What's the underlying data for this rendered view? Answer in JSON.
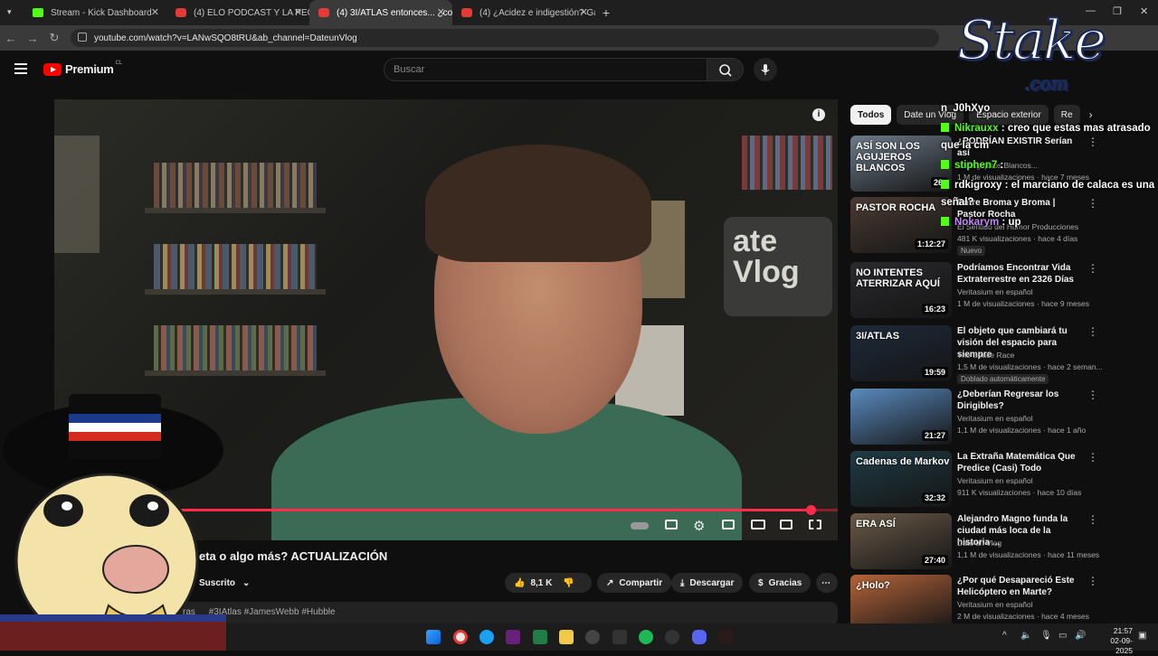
{
  "browser": {
    "tabs": [
      {
        "title": "Stream - Kick Dashboard",
        "icon": "kick-icon"
      },
      {
        "title": "(4) ELO PODCAST Y LA PEOR EN",
        "icon": "youtube-icon"
      },
      {
        "title": "(4) 3I/ATLAS entonces... ¿come",
        "icon": "youtube-icon"
      },
      {
        "title": "(4) ¿Acidez e indigestión? Gavis",
        "icon": "youtube-icon"
      }
    ],
    "url": "youtube.com/watch?v=LANwSQO8tRU&ab_channel=DateunVlog"
  },
  "youtube": {
    "logo": "Premium",
    "region": "CL",
    "search_placeholder": "Buscar"
  },
  "video": {
    "title_fragment": "eta o algo más? ACTUALIZACIÓN",
    "subscribe_label": "Suscrito",
    "likes": "8,1 K",
    "share": "Compartir",
    "download": "Descargar",
    "thanks": "Gracias",
    "desc_partial": "ras",
    "hashtags": "#3IAtlas #JamesWebb #Hubble",
    "progress_fraction": 0.965
  },
  "chips": [
    "Todos",
    "Date un Vlog",
    "Espacio exterior",
    "Re"
  ],
  "recommendations": [
    {
      "title": "¿PODRÍAN EXISTIR Serían así",
      "channel": "Los Agujeros Blancos...",
      "meta": "1 M de visualizaciones · hace 7 meses",
      "duration": "26:",
      "thumb_text": "ASÍ SON LOS AGUJEROS BLANCOS",
      "thumb_color": "#6d7b8a"
    },
    {
      "title": "Entre Broma y Broma | Pastor Rocha",
      "channel": "El Sentido del Humor Producciones",
      "meta": "481 K visualizaciones · hace 4 días",
      "badge": "Nuevo",
      "duration": "1:12:27",
      "thumb_text": "PASTOR ROCHA",
      "thumb_color": "#4a3b33"
    },
    {
      "title": "Podríamos Encontrar Vida Extraterrestre en 2326 Días",
      "channel": "Veritasium en español",
      "meta": "1 M de visualizaciones · hace 9 meses",
      "duration": "16:23",
      "thumb_text": "NO INTENTES ATERRIZAR AQUÍ",
      "thumb_color": "#2a2a2e"
    },
    {
      "title": "El objeto que cambiará tu visión del espacio para siempre",
      "channel": "The Space Race",
      "meta": "1,5 M de visualizaciones · hace 2 seman...",
      "badge": "Doblado automáticamente",
      "duration": "19:59",
      "thumb_text": "3I/ATLAS",
      "thumb_color": "#1e2a3a"
    },
    {
      "title": "¿Deberían Regresar los Dirigibles?",
      "channel": "Veritasium en español",
      "meta": "1,1 M de visualizaciones · hace 1 año",
      "duration": "21:27",
      "thumb_text": "",
      "thumb_color": "#5a8bbf"
    },
    {
      "title": "La Extraña Matemática Que Predice (Casi) Todo",
      "channel": "Veritasium en español",
      "meta": "911 K visualizaciones · hace 10 días",
      "duration": "32:32",
      "thumb_text": "Cadenas de Markov",
      "thumb_color": "#1f3b44"
    },
    {
      "title": "Alejandro Magno funda la ciudad más loca de la historia ...",
      "channel": "Date un Vlog",
      "meta": "1,1 M de visualizaciones · hace 11 meses",
      "duration": "27:40",
      "thumb_text": "ERA ASÍ",
      "thumb_color": "#6a5a48"
    },
    {
      "title": "¿Por qué Desapareció Este Helicóptero en Marte?",
      "channel": "Veritasium en español",
      "meta": "2 M de visualizaciones · hace 4 meses",
      "duration": "",
      "thumb_text": "¿Holo?",
      "thumb_color": "#b5643a"
    }
  ],
  "overlay": {
    "brand": "Stake",
    "brand_suffix": ".com",
    "chat": [
      {
        "user": "n_J0hXyo",
        "msg": "",
        "user_color": "#ffffff"
      },
      {
        "user": "Nikrauxx",
        "msg": ": creo que estas mas atrasado",
        "user_color": "#53fc18"
      },
      {
        "user": "",
        "msg": "que la cm",
        "user_color": "#ffffff"
      },
      {
        "user": "stiphen7",
        "msg": ":",
        "user_color": "#53fc18"
      },
      {
        "user": "rdkigroxy",
        "msg": ": el marciano de calaca es una",
        "user_color": "#ffffff"
      },
      {
        "user": "",
        "msg": "señal?",
        "user_color": "#ffffff"
      },
      {
        "user": "Nokarym",
        "msg": ": up",
        "user_color": "#c58af9"
      }
    ]
  },
  "taskbar": {
    "time": "21:57",
    "date": "02-09-2025"
  }
}
